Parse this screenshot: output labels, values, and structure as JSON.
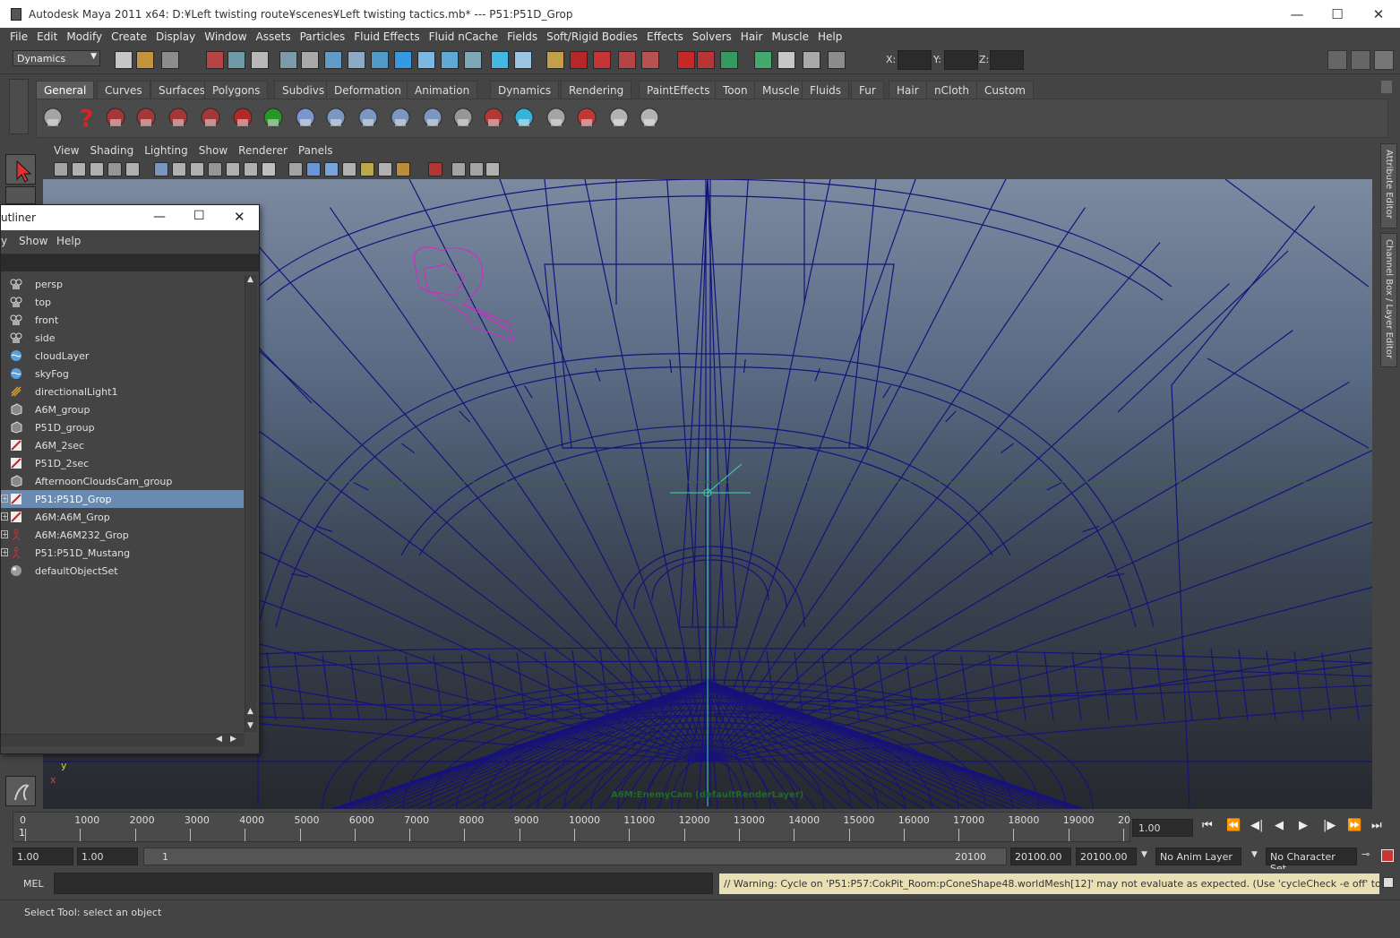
{
  "window": {
    "title": "Autodesk Maya 2011 x64: D:¥Left twisting route¥scenes¥Left twisting tactics.mb*   ---   P51:P51D_Grop",
    "minimize": "—",
    "maximize": "☐",
    "close": "✕"
  },
  "menubar": [
    "File",
    "Edit",
    "Modify",
    "Create",
    "Display",
    "Window",
    "Assets",
    "Particles",
    "Fluid Effects",
    "Fluid nCache",
    "Fields",
    "Soft/Rigid Bodies",
    "Effects",
    "Solvers",
    "Hair",
    "Muscle",
    "Help"
  ],
  "statusline": {
    "menuset": "Dynamics",
    "x_label": "X:",
    "y_label": "Y:",
    "z_label": "Z:"
  },
  "shelf": {
    "tabs": [
      "General",
      "Curves",
      "Surfaces",
      "Polygons",
      "Subdivs",
      "Deformation",
      "Animation",
      "Dynamics",
      "Rendering",
      "PaintEffects",
      "Toon",
      "Muscle",
      "Fluids",
      "Fur",
      "Hair",
      "nCloth",
      "Custom"
    ],
    "active_tab": "General"
  },
  "viewport": {
    "menu": [
      "View",
      "Shading",
      "Lighting",
      "Show",
      "Renderer",
      "Panels"
    ],
    "camera_label": "A6M:EnemyCam (defaultRenderLayer)",
    "axis_y": "y",
    "axis_x": "x",
    "wire_color": "#16127a",
    "selection_color": "#dd22cc"
  },
  "right_tabs": {
    "attribute_editor": "Attribute Editor",
    "channel_box": "Channel Box / Layer Editor"
  },
  "outliner": {
    "title": "Outliner",
    "title_visible": "utliner",
    "menu": [
      "y",
      "Show",
      "Help"
    ],
    "items": [
      {
        "label": "persp",
        "icon": "camera-icon",
        "expander": ""
      },
      {
        "label": "top",
        "icon": "camera-icon",
        "expander": ""
      },
      {
        "label": "front",
        "icon": "camera-icon",
        "expander": ""
      },
      {
        "label": "side",
        "icon": "camera-icon",
        "expander": ""
      },
      {
        "label": "cloudLayer",
        "icon": "fluid-icon",
        "expander": ""
      },
      {
        "label": "skyFog",
        "icon": "fluid-icon",
        "expander": ""
      },
      {
        "label": "directionalLight1",
        "icon": "light-icon",
        "expander": ""
      },
      {
        "label": "A6M_group",
        "icon": "group-icon",
        "expander": ""
      },
      {
        "label": "P51D_group",
        "icon": "group-icon",
        "expander": ""
      },
      {
        "label": "A6M_2sec",
        "icon": "curve-icon",
        "expander": ""
      },
      {
        "label": "P51D_2sec",
        "icon": "curve-icon",
        "expander": ""
      },
      {
        "label": "AfternoonCloudsCam_group",
        "icon": "group-icon",
        "expander": ""
      },
      {
        "label": "P51:P51D_Grop",
        "icon": "curve-icon",
        "expander": "+",
        "selected": true
      },
      {
        "label": "A6M:A6M_Grop",
        "icon": "curve-icon",
        "expander": "+"
      },
      {
        "label": "A6M:A6M232_Grop",
        "icon": "joint-icon",
        "expander": "+"
      },
      {
        "label": "P51:P51D_Mustang",
        "icon": "joint-icon",
        "expander": "+"
      },
      {
        "label": "defaultObjectSet",
        "icon": "set-icon",
        "expander": ""
      }
    ]
  },
  "timeline": {
    "ticks": [
      "0",
      "1000",
      "2000",
      "3000",
      "4000",
      "5000",
      "6000",
      "7000",
      "8000",
      "9000",
      "10000",
      "11000",
      "12000",
      "13000",
      "14000",
      "15000",
      "16000",
      "17000",
      "18000",
      "19000",
      "20"
    ],
    "current_frame_marker": "1",
    "current_time": "1.00"
  },
  "range": {
    "start_time": "1.00",
    "playback_start": "1.00",
    "slider_start": "1",
    "slider_end": "20100",
    "playback_end": "20100.00",
    "end_time": "20100.00",
    "anim_layer": "No Anim Layer",
    "character_set": "No Character Set"
  },
  "command": {
    "language": "MEL",
    "warning": "// Warning: Cycle on 'P51:P57:CokPit_Room:pConeShape48.worldMesh[12]' may not evaluate as expected.  (Use 'cycleCheck -e off' to disable this warn"
  },
  "help_line": "Select Tool: select an object"
}
